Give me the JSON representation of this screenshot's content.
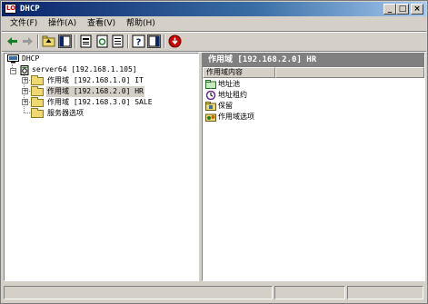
{
  "window": {
    "title": "DHCP",
    "icon_text": "LO"
  },
  "title_buttons": {
    "minimize": "_",
    "maximize": "□",
    "close": "×"
  },
  "menu": [
    {
      "label": "文件(F)"
    },
    {
      "label": "操作(A)"
    },
    {
      "label": "查看(V)"
    },
    {
      "label": "帮助(H)"
    }
  ],
  "toolbar": {
    "icons": [
      "back-icon",
      "forward-icon",
      "up-folder-icon",
      "show-tree-icon",
      "properties-icon",
      "refresh-icon",
      "export-list-icon",
      "help-icon",
      "console-icon",
      "stop-icon"
    ]
  },
  "tree": {
    "root": "DHCP",
    "server": "server64 [192.168.1.105]",
    "scopes": [
      {
        "label": "作用域 [192.168.1.0] IT",
        "expander": "+"
      },
      {
        "label": "作用域 [192.168.2.0] HR",
        "expander": "+"
      },
      {
        "label": "作用域 [192.168.3.0] SALE",
        "expander": "+"
      }
    ],
    "server_options": "服务器选项",
    "server_expander": "−"
  },
  "detail": {
    "header": "作用域 [192.168.2.0] HR",
    "column": "作用域内容",
    "items": [
      {
        "label": "地址池",
        "icon": "address-pool-icon"
      },
      {
        "label": "地址租约",
        "icon": "address-lease-icon"
      },
      {
        "label": "保留",
        "icon": "reservation-icon"
      },
      {
        "label": "作用域选项",
        "icon": "scope-options-icon"
      }
    ]
  },
  "colors": {
    "titlebar": "#0a246a",
    "chrome": "#d4d0c8",
    "header": "#808080",
    "stop": "#cc0000"
  }
}
